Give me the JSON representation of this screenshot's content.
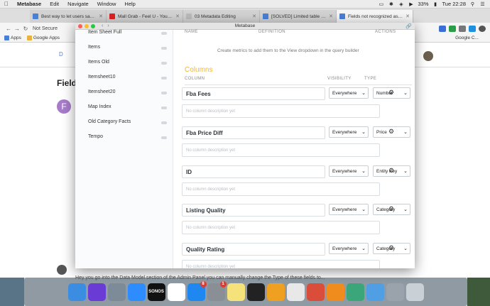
{
  "menubar": {
    "app": "Metabase",
    "items": [
      "Edit",
      "Navigate",
      "Window",
      "Help"
    ],
    "battery": "33%",
    "time": "Tue 22:28"
  },
  "tabs": [
    {
      "title": "Best way to let users save 'fav",
      "favicon_color": "#4a7fd6"
    },
    {
      "title": "Mall Grab - Feel U - YouTub",
      "favicon_color": "#e02020"
    },
    {
      "title": "03 Metadata Editing",
      "favicon_color": "#7a7a7a"
    },
    {
      "title": "[SOLVED] Limited table filters",
      "favicon_color": "#4a7fd6"
    },
    {
      "title": "Fields not recognized as Categ",
      "favicon_color": "#4a7fd6"
    }
  ],
  "address": {
    "secure_label": "Not Secure"
  },
  "bookmarks": {
    "apps": "Apps",
    "google_apps": "Google Apps",
    "right": "Google C..."
  },
  "background_page": {
    "logo": "D",
    "title": "Field",
    "avatar_letter": "F",
    "footer_text": "Hey you go into the Data Model section of the Admin Panel you can manually change the Type of these fields to..."
  },
  "window": {
    "title": "Metabase"
  },
  "sidebar": {
    "items": [
      "Item Sheet Full",
      "Items",
      "Items Old",
      "Itemsheet10",
      "Itemsheet20",
      "Map Index",
      "Old Category Facts",
      "Tempo"
    ]
  },
  "main": {
    "metrics_header": {
      "name": "NAME",
      "definition": "DEFINITION",
      "actions": "ACTIONS"
    },
    "metrics_note": "Create metrics to add them to the View dropdown in the query builder",
    "columns_title": "Columns",
    "table_header": {
      "column": "COLUMN",
      "visibility": "VISIBILITY",
      "type": "TYPE"
    },
    "columns": [
      {
        "name": "Fba Fees",
        "description": "No column description yet",
        "visibility": "Everywhere",
        "type": "Number"
      },
      {
        "name": "Fba Price Diff",
        "description": "No column description yet",
        "visibility": "Everywhere",
        "type": "Price"
      },
      {
        "name": "ID",
        "description": "No column description yet",
        "visibility": "Everywhere",
        "type": "Entity Key"
      },
      {
        "name": "Listing Quality",
        "description": "No column description yet",
        "visibility": "Everywhere",
        "type": "Category"
      },
      {
        "name": "Quality Rating",
        "description": "No column description yet",
        "visibility": "Everywhere",
        "type": "Category"
      }
    ]
  },
  "dock": {
    "apps": [
      {
        "name": "finder-app",
        "color": "#3a8de0",
        "label": ""
      },
      {
        "name": "siri-app",
        "color": "#6b3bd6",
        "label": ""
      },
      {
        "name": "launchpad-app",
        "color": "#7d8a97",
        "label": ""
      },
      {
        "name": "zoom-app",
        "color": "#2d8cff",
        "label": ""
      },
      {
        "name": "sonos-app",
        "color": "#111111",
        "label": "SONOS"
      },
      {
        "name": "slack-app",
        "color": "#ffffff",
        "label": ""
      },
      {
        "name": "app-store-app",
        "color": "#1e88f0",
        "label": "",
        "badge": "8"
      },
      {
        "name": "system-preferences-app",
        "color": "#8a8f96",
        "label": "",
        "badge": "1"
      },
      {
        "name": "notes-app",
        "color": "#f5e27a",
        "label": ""
      },
      {
        "name": "terminal-app",
        "color": "#222222",
        "label": ""
      },
      {
        "name": "sublime-app",
        "color": "#f0a020",
        "label": ""
      },
      {
        "name": "chrome-app",
        "color": "#e8e8e8",
        "label": ""
      },
      {
        "name": "setapp-app",
        "color": "#d94d3a",
        "label": ""
      },
      {
        "name": "books-app",
        "color": "#f08c1e",
        "label": ""
      },
      {
        "name": "lab-app",
        "color": "#3aa67a",
        "label": ""
      },
      {
        "name": "metabase-app",
        "color": "#509ee3",
        "label": ""
      },
      {
        "name": "downloads-app",
        "color": "#9aa3ab",
        "label": ""
      },
      {
        "name": "trash-app",
        "color": "#c9d0d6",
        "label": ""
      }
    ]
  }
}
